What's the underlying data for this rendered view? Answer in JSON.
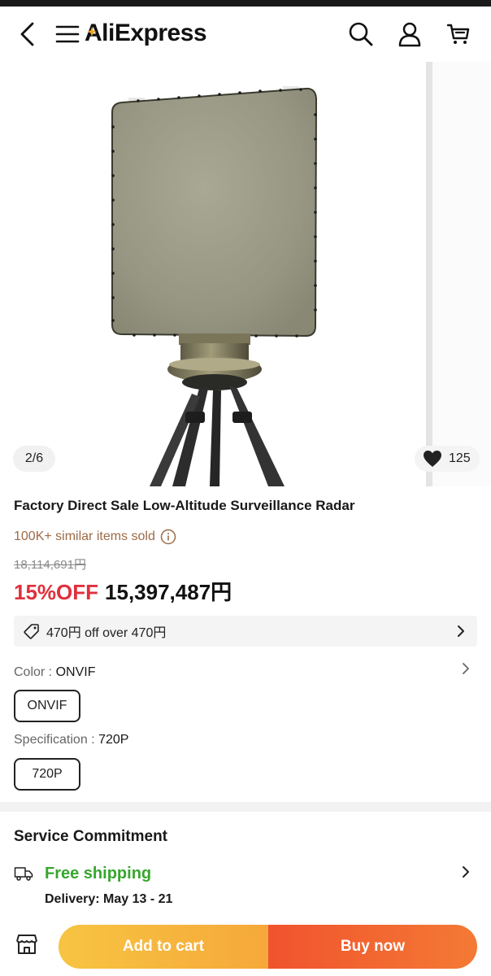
{
  "header": {
    "logo_text": "liExpress",
    "logo_letter": "A"
  },
  "gallery": {
    "counter": "2/6",
    "wishlist_count": "125"
  },
  "product": {
    "title": "Factory Direct Sale Low-Altitude Surveillance Radar",
    "sold": "100K+ similar items sold",
    "original_price": "18,114,691円",
    "discount": "15%OFF",
    "price": "15,397,487円"
  },
  "coupon": {
    "text": "470円 off over 470円"
  },
  "sku": {
    "color_label": "Color : ",
    "color_value": "ONVIF",
    "color_option": "ONVIF",
    "spec_label": "Specification : ",
    "spec_value": "720P",
    "spec_option": "720P"
  },
  "service": {
    "title": "Service Commitment",
    "shipping": "Free shipping",
    "delivery": "Delivery: May 13 - 21"
  },
  "actions": {
    "add_to_cart": "Add to cart",
    "buy_now": "Buy now"
  },
  "colors": {
    "discount": "#e0303c",
    "shipping": "#36a62d",
    "cart_button": "#f6b53e",
    "buy_button": "#f0532e",
    "sold_text": "#9c6b47"
  }
}
